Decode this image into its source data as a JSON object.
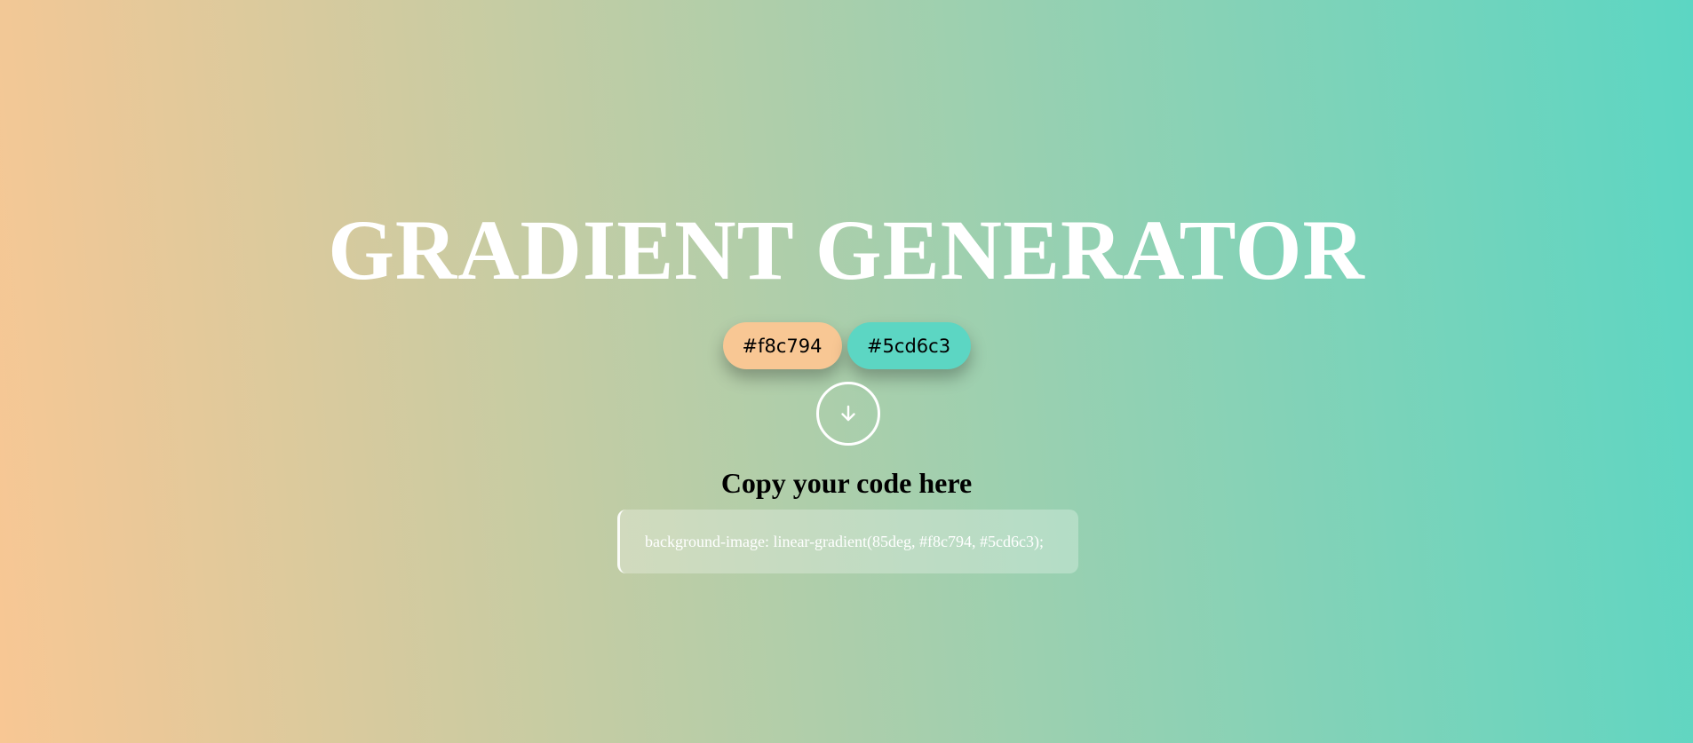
{
  "page": {
    "title": "GRADIENT GENERATOR",
    "gradient_angle": "85deg"
  },
  "colors": {
    "color1": {
      "label": "#f8c794",
      "value": "#f8c794"
    },
    "color2": {
      "label": "#5cd6c3",
      "value": "#5cd6c3"
    }
  },
  "actions": {
    "generate_icon": "arrow-down-icon"
  },
  "output": {
    "heading": "Copy your code here",
    "code": "background-image: linear-gradient(85deg, #f8c794, #5cd6c3);"
  }
}
